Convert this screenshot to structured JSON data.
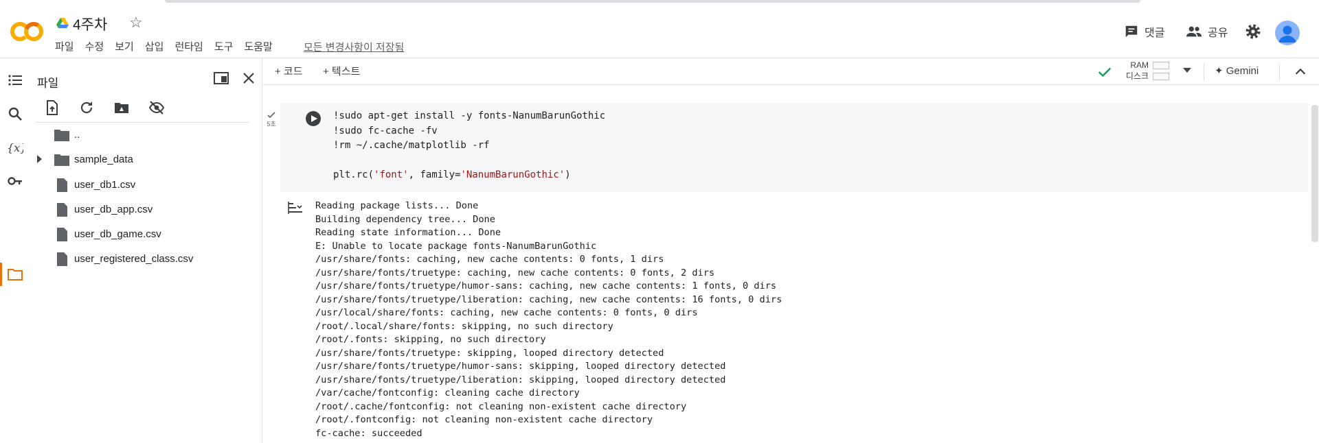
{
  "header": {
    "title": "4주차",
    "logo_text": "CO",
    "menu": [
      "파일",
      "수정",
      "보기",
      "삽입",
      "런타임",
      "도구",
      "도움말"
    ],
    "save_status": "모든 변경사항이 저장됨",
    "comment_label": "댓글",
    "share_label": "공유"
  },
  "files_panel": {
    "title": "파일",
    "items": [
      {
        "name": "..",
        "type": "folder-up"
      },
      {
        "name": "sample_data",
        "type": "folder"
      },
      {
        "name": "user_db1.csv",
        "type": "file"
      },
      {
        "name": "user_db_app.csv",
        "type": "file"
      },
      {
        "name": "user_db_game.csv",
        "type": "file"
      },
      {
        "name": "user_registered_class.csv",
        "type": "file"
      }
    ]
  },
  "toolbar": {
    "add_code": "+ 코드",
    "add_text": "+ 텍스트",
    "ram_label": "RAM",
    "disk_label": "디스크",
    "gemini_label": "Gemini"
  },
  "cell": {
    "exec_time": "5초",
    "code_lines": [
      "!sudo apt-get install -y fonts-NanumBarunGothic",
      "!sudo fc-cache -fv",
      "!rm ~/.cache/matplotlib -rf",
      "",
      "plt.rc("
    ],
    "code_str1": "'font'",
    "code_mid": ", family=",
    "code_str2": "'NanumBarunGothic'",
    "code_end": ")",
    "output": "Reading package lists... Done\nBuilding dependency tree... Done\nReading state information... Done\nE: Unable to locate package fonts-NanumBarunGothic\n/usr/share/fonts: caching, new cache contents: 0 fonts, 1 dirs\n/usr/share/fonts/truetype: caching, new cache contents: 0 fonts, 2 dirs\n/usr/share/fonts/truetype/humor-sans: caching, new cache contents: 1 fonts, 0 dirs\n/usr/share/fonts/truetype/liberation: caching, new cache contents: 16 fonts, 0 dirs\n/usr/local/share/fonts: caching, new cache contents: 0 fonts, 0 dirs\n/root/.local/share/fonts: skipping, no such directory\n/root/.fonts: skipping, no such directory\n/usr/share/fonts/truetype: skipping, looped directory detected\n/usr/share/fonts/truetype/humor-sans: skipping, looped directory detected\n/usr/share/fonts/truetype/liberation: skipping, looped directory detected\n/var/cache/fontconfig: cleaning cache directory\n/root/.cache/fontconfig: not cleaning non-existent cache directory\n/root/.fontconfig: not cleaning non-existent cache directory\nfc-cache: succeeded"
  },
  "colors": {
    "logo_orange": "#f9ab00",
    "logo_dark_orange": "#e8710a",
    "string": "#a31515",
    "check_green": "#0f9d58"
  }
}
